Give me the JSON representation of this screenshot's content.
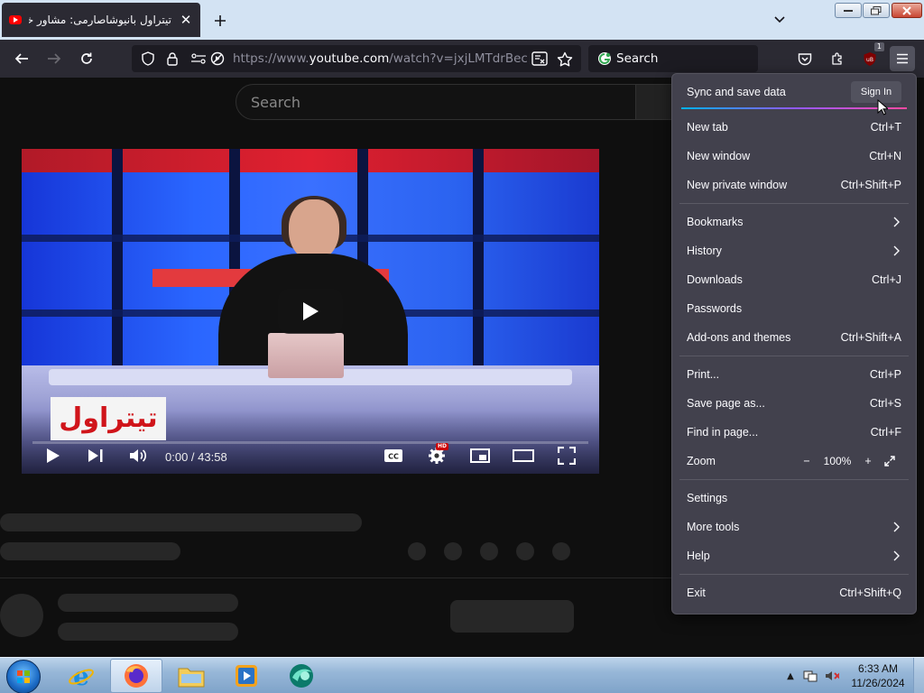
{
  "browser": {
    "tab": {
      "title": "تیتراول بانیوشاصارمی: مشاور خام"
    },
    "url": {
      "prefix": "https://www.",
      "domain": "youtube.com",
      "path": "/watch?v=jxjLMTdrBec"
    },
    "search_placeholder": "Search",
    "extension_badge": "1"
  },
  "youtube": {
    "search_placeholder": "Search",
    "player": {
      "time": "0:00 / 43:58",
      "channel_logo_text": "تیتراول",
      "hd_badge": "HD"
    }
  },
  "app_menu": {
    "sync_label": "Sync and save data",
    "sign_in_label": "Sign In",
    "items": [
      {
        "label": "New tab",
        "shortcut": "Ctrl+T"
      },
      {
        "label": "New window",
        "shortcut": "Ctrl+N"
      },
      {
        "label": "New private window",
        "shortcut": "Ctrl+Shift+P"
      },
      {
        "label": "Bookmarks",
        "shortcut": ""
      },
      {
        "label": "History",
        "shortcut": ""
      },
      {
        "label": "Downloads",
        "shortcut": "Ctrl+J"
      },
      {
        "label": "Passwords",
        "shortcut": ""
      },
      {
        "label": "Add-ons and themes",
        "shortcut": "Ctrl+Shift+A"
      },
      {
        "label": "Print...",
        "shortcut": "Ctrl+P"
      },
      {
        "label": "Save page as...",
        "shortcut": "Ctrl+S"
      },
      {
        "label": "Find in page...",
        "shortcut": "Ctrl+F"
      },
      {
        "label": "Zoom",
        "shortcut": ""
      },
      {
        "label": "Settings",
        "shortcut": ""
      },
      {
        "label": "More tools",
        "shortcut": ""
      },
      {
        "label": "Help",
        "shortcut": ""
      },
      {
        "label": "Exit",
        "shortcut": "Ctrl+Shift+Q"
      }
    ],
    "zoom": {
      "minus": "−",
      "level": "100%",
      "plus": "+"
    }
  },
  "taskbar": {
    "clock_time": "6:33 AM",
    "clock_date": "11/26/2024"
  },
  "colors": {
    "menu_bg": "#42414d",
    "toolbar_bg": "#2b2a33",
    "yt_red": "#ff0000",
    "sync_gradient": [
      "#00b3f4",
      "#9059ff",
      "#ff4aa2"
    ]
  },
  "icons": {
    "nav": [
      "back-arrow-icon",
      "forward-arrow-icon",
      "reload-icon"
    ],
    "url": [
      "tracking-shield-icon",
      "lock-icon",
      "permissions-icon",
      "autoplay-blocked-icon"
    ],
    "toolbar": [
      "reader-view-icon",
      "bookmark-star-icon",
      "pocket-icon",
      "extensions-puzzle-icon",
      "ublock-extension-icon",
      "hamburger-menu-icon"
    ]
  }
}
